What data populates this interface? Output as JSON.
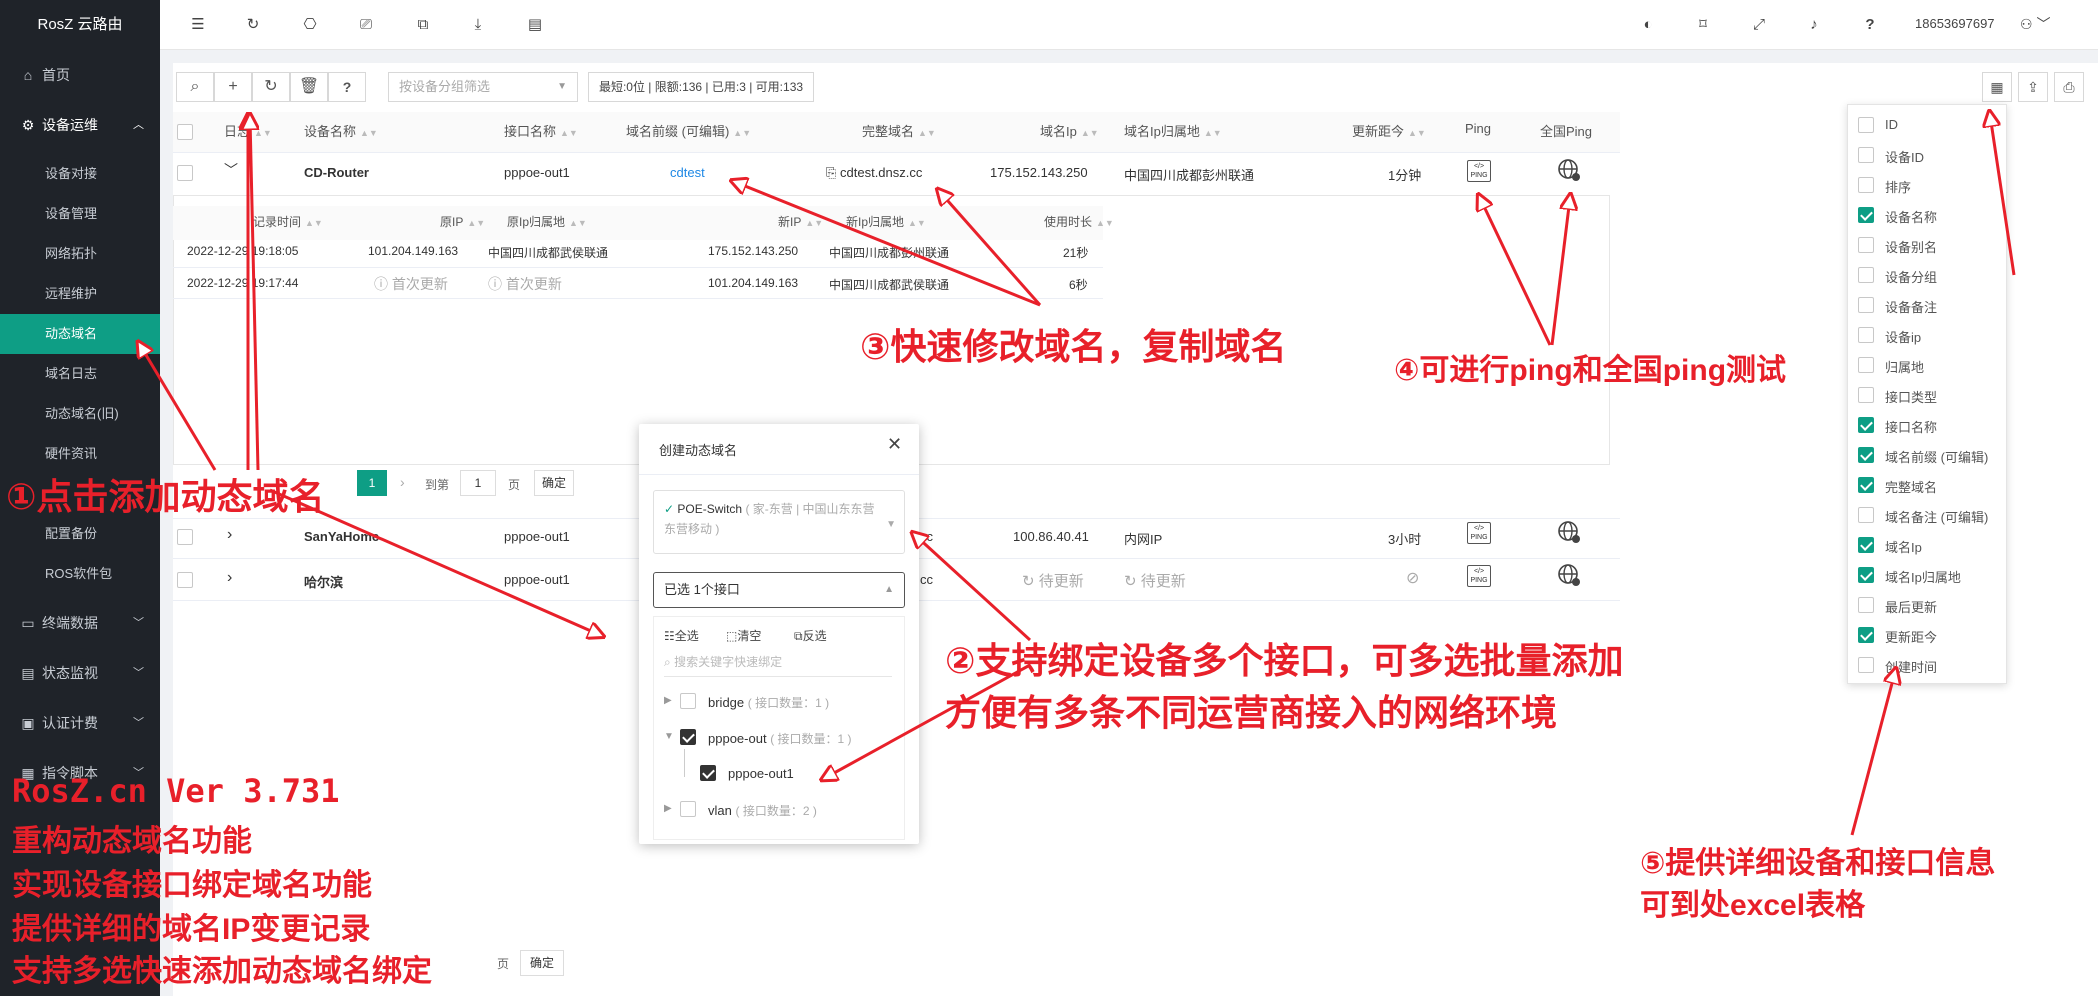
{
  "app": {
    "brand": "RosZ 云路由",
    "user": "18653697697"
  },
  "nav": {
    "home": "首页",
    "devops": "设备运维",
    "subitems": [
      "设备对接",
      "设备管理",
      "网络拓扑",
      "远程维护",
      "动态域名",
      "域名日志",
      "动态域名(旧)",
      "硬件资讯"
    ],
    "hidden_items": [
      "配置备份",
      "ROS软件包"
    ],
    "groups": [
      "终端数据",
      "状态监视",
      "认证计费",
      "指令脚本"
    ]
  },
  "toolbar": {
    "filter_placeholder": "按设备分组筛选",
    "stats": "最短:0位 | 限额:136 | 已用:3 | 可用:133"
  },
  "table": {
    "headers": [
      "日志",
      "设备名称",
      "接口名称",
      "域名前缀 (可编辑)",
      "完整域名",
      "域名Ip",
      "域名Ip归属地",
      "更新距今",
      "Ping",
      "全国Ping"
    ],
    "rows": [
      {
        "device": "CD-Router",
        "iface": "pppoe-out1",
        "prefix": "cdtest",
        "full": "cdtest.dnsz.cc",
        "ip": "175.152.143.250",
        "loc": "中国四川成都彭州联通",
        "ago": "1分钟"
      },
      {
        "device": "SanYaHome",
        "iface": "pppoe-out1",
        "prefix": "",
        "full": "cc",
        "ip": "100.86.40.41",
        "loc": "内网IP",
        "ago": "3小时"
      },
      {
        "device": "哈尔滨",
        "iface": "pppoe-out1",
        "prefix": "",
        "full": "cc",
        "ip": "待更新",
        "loc": "待更新",
        "ago": ""
      }
    ]
  },
  "log": {
    "headers": [
      "记录时间",
      "原IP",
      "原Ip归属地",
      "新IP",
      "新Ip归属地",
      "使用时长"
    ],
    "rows": [
      {
        "time": "2022-12-29 19:18:05",
        "old_ip": "101.204.149.163",
        "old_loc": "中国四川成都武侯联通",
        "new_ip": "175.152.143.250",
        "new_loc": "中国四川成都彭州联通",
        "dur": "21秒"
      },
      {
        "time": "2022-12-29 19:17:44",
        "old_ip": "首次更新",
        "old_loc": "首次更新",
        "new_ip": "101.204.149.163",
        "new_loc": "中国四川成都武侯联通",
        "dur": "6秒"
      }
    ]
  },
  "pager": {
    "page": "1",
    "goto": "到第",
    "page_input": "1",
    "page_unit": "页",
    "confirm": "确定"
  },
  "modal": {
    "title": "创建动态域名",
    "device": "POE-Switch",
    "device_note": "( 家-东营 | 中国山东东营东营移动 )",
    "selected": "已选 1个接口",
    "select_all": "全选",
    "clear": "清空",
    "invert": "反选",
    "search_placeholder": "搜索关键字快速绑定",
    "tree": [
      {
        "label": "bridge",
        "count": "( 接口数量：1 )",
        "checked": false
      },
      {
        "label": "pppoe-out",
        "count": "( 接口数量：1 )",
        "checked": true
      },
      {
        "label": "pppoe-out1",
        "count": "",
        "checked": true
      },
      {
        "label": "vlan",
        "count": "( 接口数量：2 )",
        "checked": false
      }
    ]
  },
  "columns": [
    {
      "label": "ID",
      "checked": false
    },
    {
      "label": "设备ID",
      "checked": false
    },
    {
      "label": "排序",
      "checked": false
    },
    {
      "label": "设备名称",
      "checked": true
    },
    {
      "label": "设备别名",
      "checked": false
    },
    {
      "label": "设备分组",
      "checked": false
    },
    {
      "label": "设备备注",
      "checked": false
    },
    {
      "label": "设备ip",
      "checked": false
    },
    {
      "label": "归属地",
      "checked": false
    },
    {
      "label": "接口类型",
      "checked": false
    },
    {
      "label": "接口名称",
      "checked": true
    },
    {
      "label": "域名前缀 (可编辑)",
      "checked": true
    },
    {
      "label": "完整域名",
      "checked": true
    },
    {
      "label": "域名备注 (可编辑)",
      "checked": false
    },
    {
      "label": "域名Ip",
      "checked": true
    },
    {
      "label": "域名Ip归属地",
      "checked": true
    },
    {
      "label": "最后更新",
      "checked": false
    },
    {
      "label": "更新距今",
      "checked": true
    },
    {
      "label": "创建时间",
      "checked": false
    }
  ],
  "annotations": {
    "a1": "①点击添加动态域名",
    "a2_line1": "②支持绑定设备多个接口，可多选批量添加",
    "a2_line2": "方便有多条不同运营商接入的网络环境",
    "a3": "③快速修改域名，复制域名",
    "a4": "④可进行ping和全国ping测试",
    "a5_line1": "⑤提供详细设备和接口信息",
    "a5_line2": "可到处excel表格",
    "version": "RosZ.cn Ver 3.731",
    "notes": [
      "重构动态域名功能",
      "实现设备接口绑定域名功能",
      "提供详细的域名IP变更记录",
      "支持多选快速添加动态域名绑定"
    ]
  },
  "bottom": {
    "page_unit": "页",
    "confirm": "确定"
  },
  "colors": {
    "accent": "#0e9e85",
    "annotation": "#e8202a",
    "sidebar": "#1f2329"
  }
}
